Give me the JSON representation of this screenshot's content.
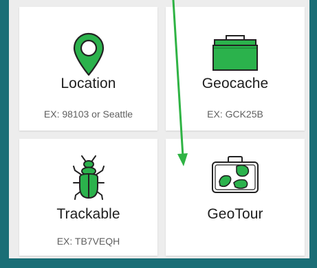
{
  "colors": {
    "background": "#1a6e76",
    "panel": "#ededed",
    "card": "#ffffff",
    "accent_green": "#2bb24c",
    "icon_outline": "#222222",
    "annotation_arrow": "#2fb344"
  },
  "cards": [
    {
      "icon": "location-pin-icon",
      "title": "Location",
      "hint": "EX: 98103 or Seattle"
    },
    {
      "icon": "ammo-can-icon",
      "title": "Geocache",
      "hint": "EX: GCK25B"
    },
    {
      "icon": "beetle-icon",
      "title": "Trackable",
      "hint": "EX: TB7VEQH"
    },
    {
      "icon": "suitcase-icon",
      "title": "GeoTour",
      "hint": ""
    }
  ]
}
